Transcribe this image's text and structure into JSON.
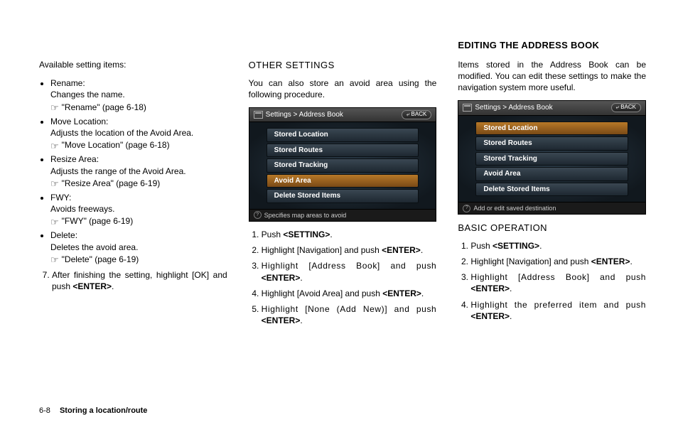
{
  "col1": {
    "intro": "Available setting items:",
    "items": [
      {
        "name": "Rename:",
        "desc": "Changes the name.",
        "ref": "\"Rename\" (page 6-18)"
      },
      {
        "name": "Move Location:",
        "desc": "Adjusts the location of the Avoid Area.",
        "ref": "\"Move Location\" (page 6-18)"
      },
      {
        "name": "Resize Area:",
        "desc": "Adjusts the range of the Avoid Area.",
        "ref": "\"Resize Area\" (page 6-19)"
      },
      {
        "name": "FWY:",
        "desc": "Avoids freeways.",
        "ref": "\"FWY\" (page 6-19)"
      },
      {
        "name": "Delete:",
        "desc": "Deletes the avoid area.",
        "ref": "\"Delete\" (page 6-19)"
      }
    ],
    "step7_a": "After finishing the setting, highlight [OK] and push ",
    "step7_b": "<ENTER>",
    "step7_c": "."
  },
  "col2": {
    "heading": "OTHER SETTINGS",
    "intro": "You can also store an avoid area using the following procedure.",
    "screenshot": {
      "title": "Settings > Address Book",
      "back": "BACK",
      "rows": [
        "Stored Location",
        "Stored Routes",
        "Stored Tracking",
        "Avoid Area",
        "Delete Stored Items"
      ],
      "selected_index": 3,
      "status": "Specifies map areas to avoid"
    },
    "steps": {
      "s1a": "Push ",
      "s1b": "<SETTING>",
      "s1c": ".",
      "s2a": "Highlight [Navigation] and push ",
      "s2b": "<ENTER>",
      "s2c": ".",
      "s3a": "Highlight [Address Book] and push ",
      "s3b": "<ENTER>",
      "s3c": ".",
      "s4a": "Highlight [Avoid Area] and push ",
      "s4b": "<ENTER>",
      "s4c": ".",
      "s5a": "Highlight [None (Add New)] and push ",
      "s5b": "<ENTER>",
      "s5c": "."
    }
  },
  "col3": {
    "heading": "EDITING THE ADDRESS BOOK",
    "intro": "Items stored in the Address Book can be modified. You can edit these settings to make the navigation system more useful.",
    "screenshot": {
      "title": "Settings > Address Book",
      "back": "BACK",
      "rows": [
        "Stored Location",
        "Stored Routes",
        "Stored Tracking",
        "Avoid Area",
        "Delete Stored Items"
      ],
      "selected_index": 0,
      "status": "Add or edit saved destination"
    },
    "subhead": "BASIC OPERATION",
    "steps": {
      "s1a": "Push ",
      "s1b": "<SETTING>",
      "s1c": ".",
      "s2a": "Highlight [Navigation] and push ",
      "s2b": "<ENTER>",
      "s2c": ".",
      "s3a": "Highlight [Address Book] and push ",
      "s3b": "<ENTER>",
      "s3c": ".",
      "s4a": "Highlight the preferred item and push ",
      "s4b": "<ENTER>",
      "s4c": "."
    }
  },
  "footer": {
    "page": "6-8",
    "title": "Storing a location/route"
  }
}
